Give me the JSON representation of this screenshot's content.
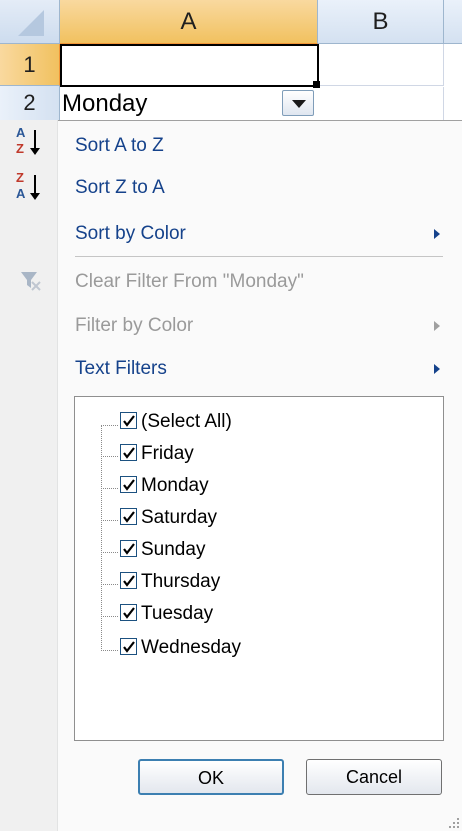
{
  "grid": {
    "columns": [
      "A",
      "B"
    ],
    "rows": [
      "1",
      "2"
    ],
    "cell_a2": "Monday"
  },
  "menu": {
    "sort_az": "Sort A to Z",
    "sort_za": "Sort Z to A",
    "sort_by_color": "Sort by Color",
    "clear_filter": "Clear Filter From \"Monday\"",
    "filter_by_color": "Filter by Color",
    "text_filters": "Text Filters"
  },
  "checklist": {
    "items": [
      {
        "label": "(Select All)",
        "checked": true
      },
      {
        "label": "Friday",
        "checked": true
      },
      {
        "label": "Monday",
        "checked": true
      },
      {
        "label": "Saturday",
        "checked": true
      },
      {
        "label": "Sunday",
        "checked": true
      },
      {
        "label": "Thursday",
        "checked": true
      },
      {
        "label": "Tuesday",
        "checked": true
      },
      {
        "label": "Wednesday",
        "checked": true
      }
    ]
  },
  "buttons": {
    "ok": "OK",
    "cancel": "Cancel"
  },
  "icons": {
    "sort_az": "sort-a-to-z-icon",
    "sort_za": "sort-z-to-a-icon",
    "clear_filter": "clear-filter-icon",
    "dropdown": "dropdown-arrow-icon"
  },
  "colors": {
    "menu_text": "#15428b",
    "disabled_text": "#9a9a9a",
    "selected_header": "#f1c15f"
  }
}
